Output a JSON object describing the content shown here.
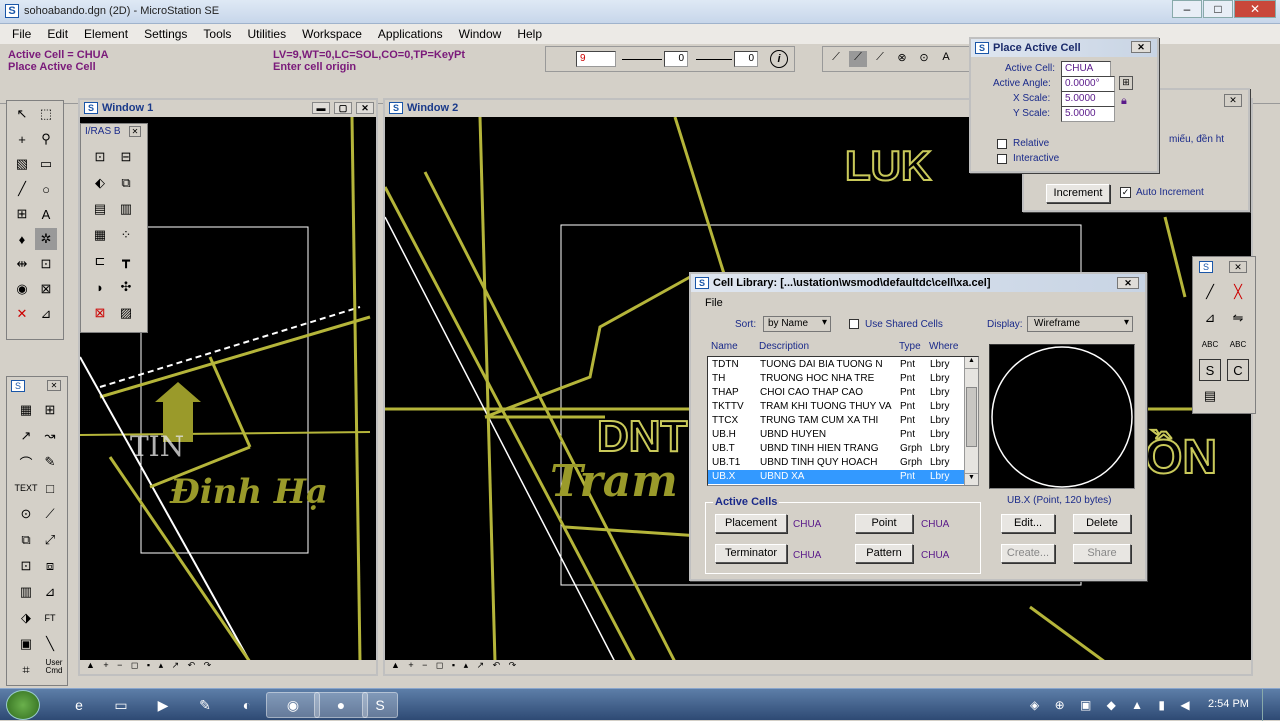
{
  "app": {
    "title": "sohoabando.dgn (2D) - MicroStation SE"
  },
  "menu": [
    "File",
    "Edit",
    "Element",
    "Settings",
    "Tools",
    "Utilities",
    "Workspace",
    "Applications",
    "Window",
    "Help"
  ],
  "status": {
    "line1": "Active Cell = CHUA",
    "line2": "Place Active Cell",
    "line3": "LV=9,WT=0,LC=SOL,CO=0,TP=KeyPt",
    "line4": "Enter cell origin",
    "level": "9",
    "weight": "0",
    "color": "0"
  },
  "window1": {
    "title": "Window 1",
    "labels": {
      "tin": "TIN",
      "dinh_ha": "Đinh Hạ"
    }
  },
  "window2": {
    "title": "Window 2",
    "labels": {
      "luk": "LUK",
      "dnt": "DNT",
      "tram": "Tram",
      "ong": "ỒN"
    }
  },
  "palettes": {
    "iras": "I/RAS B",
    "user_cmd": "User Cmd"
  },
  "place_active_cell": {
    "title": "Place Active Cell",
    "active_cell_label": "Active Cell:",
    "active_cell": "CHUA",
    "angle_label": "Active Angle:",
    "angle": "0.0000°",
    "xscale_label": "X Scale:",
    "xscale": "5.0000",
    "yscale_label": "Y Scale:",
    "yscale": "5.0000",
    "relative": "Relative",
    "interactive": "Interactive"
  },
  "back_dialog": {
    "text": "miếu, đền ht",
    "increment": "Increment",
    "auto_increment": "Auto Increment"
  },
  "cell_library": {
    "title": "Cell Library: [...\\ustation\\wsmod\\defaultdc\\cell\\xa.cel]",
    "file_menu": "File",
    "sort_label": "Sort:",
    "sort_value": "by Name",
    "use_shared": "Use Shared Cells",
    "display_label": "Display:",
    "display_value": "Wireframe",
    "columns": {
      "name": "Name",
      "description": "Description",
      "type": "Type",
      "where": "Where"
    },
    "rows": [
      {
        "name": "TDTN",
        "description": "TUONG DAI BIA TUONG N",
        "type": "Pnt",
        "where": "Lbry"
      },
      {
        "name": "TH",
        "description": "TRUONG HOC NHA TRE",
        "type": "Pnt",
        "where": "Lbry"
      },
      {
        "name": "THAP",
        "description": "CHOI CAO THAP CAO",
        "type": "Pnt",
        "where": "Lbry"
      },
      {
        "name": "TKTTV",
        "description": "TRAM KHI TUONG THUY VA",
        "type": "Pnt",
        "where": "Lbry"
      },
      {
        "name": "TTCX",
        "description": "TRUNG TAM CUM XA THI",
        "type": "Pnt",
        "where": "Lbry"
      },
      {
        "name": "UB.H",
        "description": "UBND HUYEN",
        "type": "Pnt",
        "where": "Lbry"
      },
      {
        "name": "UB.T",
        "description": "UBND TINH HIEN TRANG",
        "type": "Grph",
        "where": "Lbry"
      },
      {
        "name": "UB.T1",
        "description": "UBND TINH QUY HOACH",
        "type": "Grph",
        "where": "Lbry"
      },
      {
        "name": "UB.X",
        "description": "UBND XA",
        "type": "Pnt",
        "where": "Lbry"
      }
    ],
    "preview_caption": "UB.X (Point, 120 bytes)",
    "active_cells_label": "Active Cells",
    "placement": "Placement",
    "placement_val": "CHUA",
    "point": "Point",
    "point_val": "CHUA",
    "terminator": "Terminator",
    "terminator_val": "CHUA",
    "pattern": "Pattern",
    "pattern_val": "CHUA",
    "edit": "Edit...",
    "delete": "Delete",
    "create": "Create...",
    "share": "Share"
  },
  "taskbar": {
    "time": "2:54 PM"
  },
  "colors": {
    "cad_line": "#b5b53a",
    "cad_text": "#9a9a2a",
    "selection": "#3399ff",
    "title_text": "#1a2a8a"
  }
}
